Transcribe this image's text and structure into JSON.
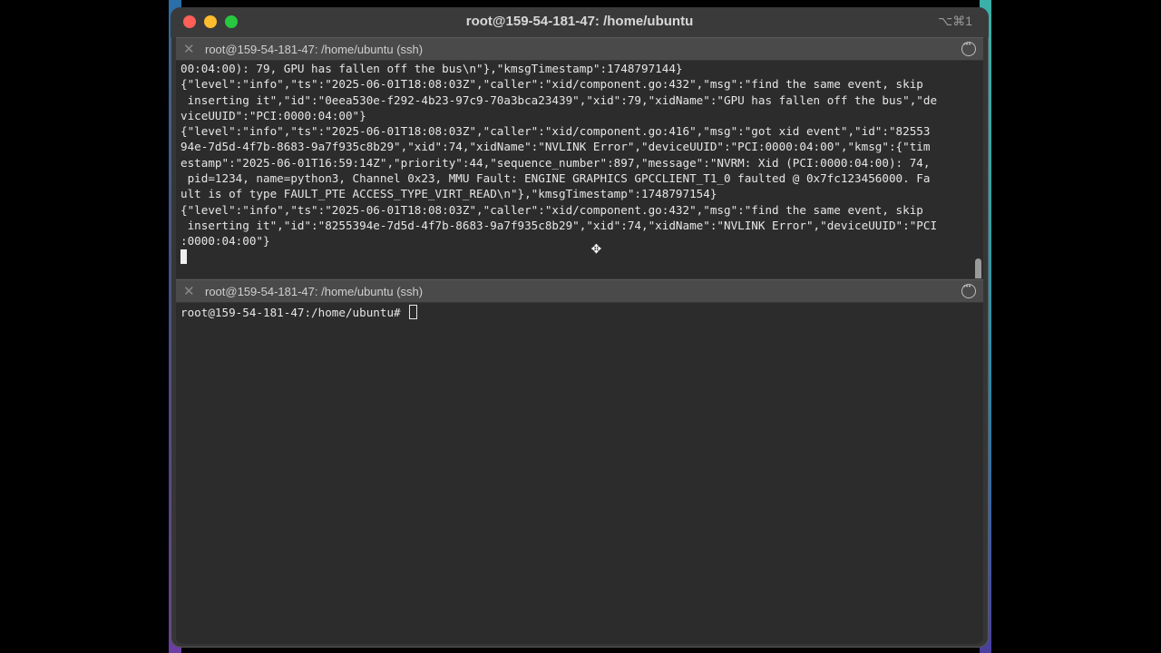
{
  "window": {
    "title": "root@159-54-181-47: /home/ubuntu",
    "shortcut": "⌥⌘1"
  },
  "top_pane": {
    "tab_title": "root@159-54-181-47: /home/ubuntu (ssh)",
    "lines": [
      "00:04:00): 79, GPU has fallen off the bus\\n\"},\"kmsgTimestamp\":1748797144}",
      "{\"level\":\"info\",\"ts\":\"2025-06-01T18:08:03Z\",\"caller\":\"xid/component.go:432\",\"msg\":\"find the same event, skip",
      " inserting it\",\"id\":\"0eea530e-f292-4b23-97c9-70a3bca23439\",\"xid\":79,\"xidName\":\"GPU has fallen off the bus\",\"de",
      "viceUUID\":\"PCI:0000:04:00\"}",
      "{\"level\":\"info\",\"ts\":\"2025-06-01T18:08:03Z\",\"caller\":\"xid/component.go:416\",\"msg\":\"got xid event\",\"id\":\"82553",
      "94e-7d5d-4f7b-8683-9a7f935c8b29\",\"xid\":74,\"xidName\":\"NVLINK Error\",\"deviceUUID\":\"PCI:0000:04:00\",\"kmsg\":{\"tim",
      "estamp\":\"2025-06-01T16:59:14Z\",\"priority\":44,\"sequence_number\":897,\"message\":\"NVRM: Xid (PCI:0000:04:00): 74,",
      " pid=1234, name=python3, Channel 0x23, MMU Fault: ENGINE GRAPHICS GPCCLIENT_T1_0 faulted @ 0x7fc123456000. Fa",
      "ult is of type FAULT_PTE ACCESS_TYPE_VIRT_READ\\n\"},\"kmsgTimestamp\":1748797154}",
      "{\"level\":\"info\",\"ts\":\"2025-06-01T18:08:03Z\",\"caller\":\"xid/component.go:432\",\"msg\":\"find the same event, skip",
      " inserting it\",\"id\":\"8255394e-7d5d-4f7b-8683-9a7f935c8b29\",\"xid\":74,\"xidName\":\"NVLINK Error\",\"deviceUUID\":\"PCI",
      ":0000:04:00\"}"
    ]
  },
  "bottom_pane": {
    "tab_title": "root@159-54-181-47: /home/ubuntu (ssh)",
    "prompt": "root@159-54-181-47:/home/ubuntu#"
  },
  "colors": {
    "close": "#fe5f57",
    "minimize": "#febc2e",
    "maximize": "#28c840",
    "terminal_bg": "#2c2c2c",
    "terminal_fg": "#e6e6e6"
  }
}
